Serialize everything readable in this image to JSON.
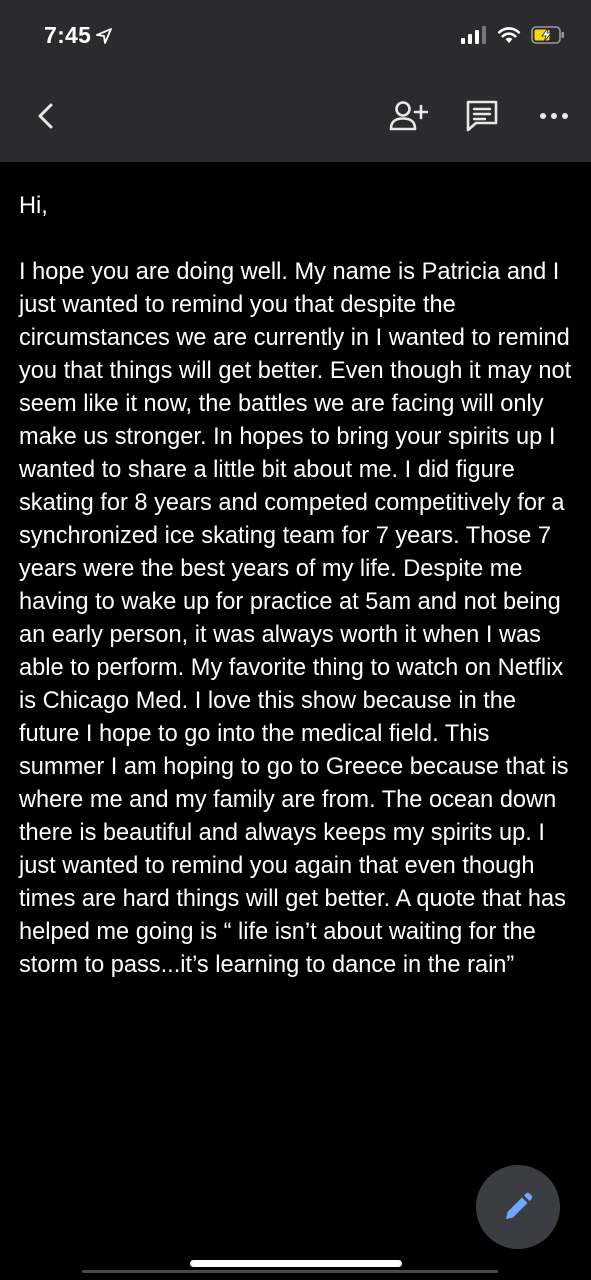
{
  "status_bar": {
    "time": "7:45",
    "icons": [
      "location-arrow-icon",
      "cellular-signal-icon",
      "wifi-icon",
      "battery-charging-icon"
    ],
    "battery_color": "#f5d90a"
  },
  "toolbar": {
    "icons": [
      "back-chevron-icon",
      "add-person-icon",
      "comment-icon",
      "more-dots-icon"
    ]
  },
  "document": {
    "greeting": "Hi,",
    "body": "I hope you are doing well. My name is Patricia and I just wanted to remind you that despite the circumstances we are currently in I wanted to remind you that things will get better. Even though it may not seem like it now, the battles we are facing will only make us stronger. In hopes to bring your spirits up I wanted to share a little bit about me. I did figure skating for 8 years and competed competitively for a synchronized ice skating team for 7 years. Those 7 years were the best years of my life. Despite me having to wake up for practice at 5am and not being an early person, it was always worth it when I was able to perform. My favorite thing to watch on Netflix is Chicago Med. I love this show because in the future I hope to go into the medical field. This summer I am hoping to go to Greece because that is where me and my family are from. The ocean down there is beautiful and always keeps my spirits up. I just wanted to remind you again that even though times are hard things will get better. A quote that has helped me going is “ life isn’t about waiting for the storm to pass...it’s learning to dance in the rain”"
  },
  "fab": {
    "icon": "edit-pencil-icon",
    "icon_color": "#6ea8fe"
  },
  "colors": {
    "chrome_bg": "#2b2b2d",
    "doc_bg": "#000000",
    "text": "#ffffff"
  }
}
